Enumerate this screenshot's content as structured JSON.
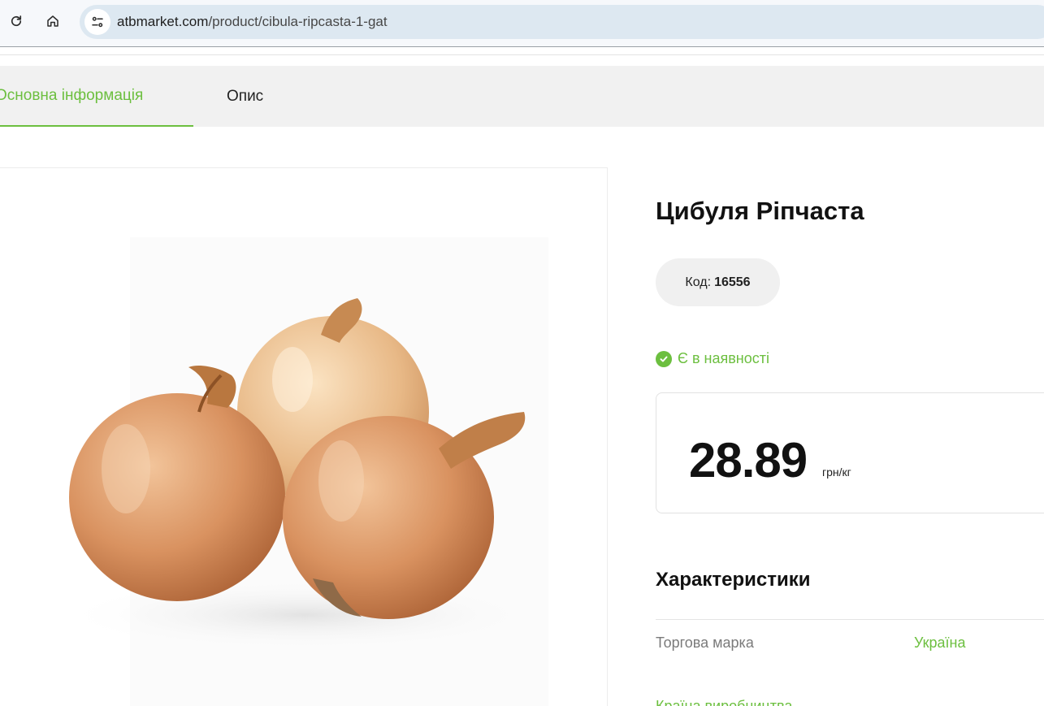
{
  "browser": {
    "url_domain": "atbmarket.com",
    "url_path": "/product/cibula-ripcasta-1-gat",
    "icons": [
      "reload-icon",
      "home-icon",
      "site-settings-icon"
    ]
  },
  "tabs": [
    {
      "label": "Основна інформація",
      "active": true
    },
    {
      "label": "Опис",
      "active": false
    }
  ],
  "product": {
    "title": "Цибуля Ріпчаста",
    "code_label": "Код:",
    "code_value": "16556",
    "stock_text": "Є в наявності",
    "price": "28.89",
    "price_unit": "грн/кг",
    "image_alt": "onions"
  },
  "specs": {
    "title": "Характеристики",
    "rows": [
      {
        "label": "Торгова марка",
        "value": "Україна"
      }
    ],
    "next_row_partial": "Країна виробництва"
  },
  "colors": {
    "accent_green": "#6cbf3f",
    "tabs_bg": "#f1f1f1",
    "pill_bg": "#f0f0f0"
  }
}
